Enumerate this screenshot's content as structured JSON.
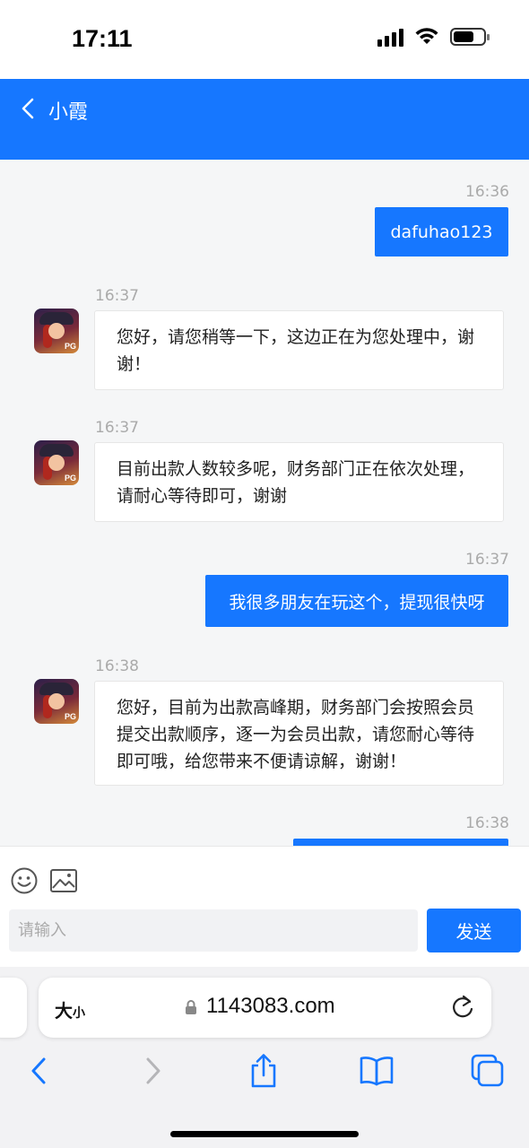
{
  "status_bar": {
    "time": "17:11"
  },
  "header": {
    "title": "小霞"
  },
  "messages": [
    {
      "time": "16:36",
      "text": "dafuhao123"
    },
    {
      "time": "16:37",
      "text": "您好，请您稍等一下，这边正在为您处理中，谢谢！",
      "avatar_badge": "PG"
    },
    {
      "time": "16:37",
      "text": "目前出款人数较多呢，财务部门正在依次处理，请耐心等待即可，谢谢",
      "avatar_badge": "PG"
    },
    {
      "time": "16:37",
      "text": "我很多朋友在玩这个，提现很快呀"
    },
    {
      "time": "16:38",
      "text": "您好，目前为出款高峰期，财务部门会按照会员提交出款顺序，逐一为会员出款，请您耐心等待即可哦，给您带来不便请谅解，谢谢！",
      "avatar_badge": "PG"
    },
    {
      "time": "16:38",
      "text": ""
    }
  ],
  "composer": {
    "placeholder": "请输入",
    "send_label": "发送"
  },
  "browser": {
    "text_size_big": "大",
    "text_size_small": "小",
    "url": "1143083.com"
  },
  "icons": {
    "back": "chevron-left-icon",
    "emoji": "smiley-icon",
    "image": "image-icon",
    "lock": "lock-icon",
    "reload": "reload-icon",
    "safari_back": "chevron-left-icon",
    "safari_forward": "chevron-right-icon",
    "share": "share-icon",
    "bookmarks": "book-icon",
    "tabs": "tabs-icon"
  },
  "colors": {
    "accent": "#1677ff",
    "chat_bg": "#f5f6f7"
  }
}
